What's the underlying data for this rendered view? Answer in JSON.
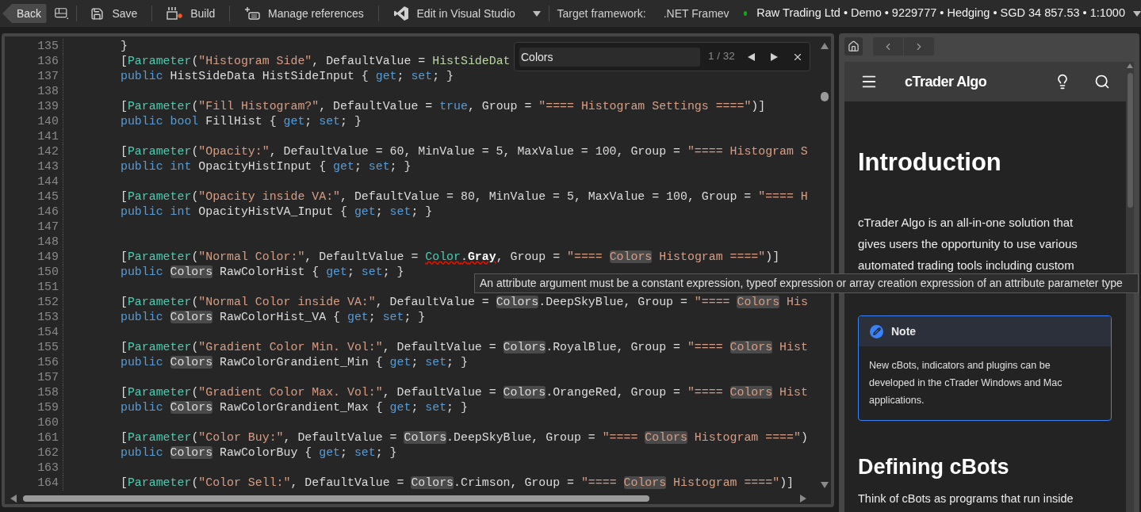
{
  "toolbar": {
    "back": "Back",
    "buttons": [
      {
        "kind": "save",
        "label": "Save"
      },
      {
        "kind": "build",
        "label": "Build"
      },
      {
        "kind": "references",
        "label": "Manage references"
      },
      {
        "kind": "visual-studio",
        "label": "Edit in Visual Studio"
      }
    ],
    "target_framework_label": "Target framework:",
    "target_framework_value": ".NET Framev",
    "account": {
      "connected": true,
      "text": "Raw Trading Ltd • Demo • 9229777 • Hedging • SGD 34 857.53 • 1:1000"
    }
  },
  "editor": {
    "lines": [
      {
        "number": "135",
        "tokens": [
          {
            "kind": "plain",
            "text": "}"
          }
        ]
      },
      {
        "number": "136",
        "tokens": [
          {
            "kind": "plain",
            "text": "["
          },
          {
            "kind": "attribute",
            "text": "Parameter"
          },
          {
            "kind": "plain",
            "text": "("
          },
          {
            "kind": "string",
            "text": "\"Histogram Side\""
          },
          {
            "kind": "plain",
            "text": ", DefaultValue = "
          },
          {
            "kind": "type",
            "text": "HistSideDat"
          }
        ]
      },
      {
        "number": "137",
        "tokens": [
          {
            "kind": "keyword",
            "text": "public"
          },
          {
            "kind": "plain",
            "text": " HistSideData HistSideInput { "
          },
          {
            "kind": "keyword",
            "text": "get"
          },
          {
            "kind": "plain",
            "text": "; "
          },
          {
            "kind": "keyword",
            "text": "set"
          },
          {
            "kind": "plain",
            "text": "; }"
          }
        ]
      },
      {
        "number": "138"
      },
      {
        "number": "139",
        "tokens": [
          {
            "kind": "plain",
            "text": "["
          },
          {
            "kind": "attribute",
            "text": "Parameter"
          },
          {
            "kind": "plain",
            "text": "("
          },
          {
            "kind": "string",
            "text": "\"Fill Histogram?\""
          },
          {
            "kind": "plain",
            "text": ", DefaultValue = "
          },
          {
            "kind": "keyword",
            "text": "true"
          },
          {
            "kind": "plain",
            "text": ", Group = "
          },
          {
            "kind": "string",
            "text": "\"==== Histogram Settings ====\""
          },
          {
            "kind": "plain",
            "text": ")]"
          }
        ]
      },
      {
        "number": "140",
        "tokens": [
          {
            "kind": "keyword",
            "text": "public "
          },
          {
            "kind": "keyword",
            "text": "bool"
          },
          {
            "kind": "plain",
            "text": " FillHist { "
          },
          {
            "kind": "keyword",
            "text": "get"
          },
          {
            "kind": "plain",
            "text": "; "
          },
          {
            "kind": "keyword",
            "text": "set"
          },
          {
            "kind": "plain",
            "text": "; }"
          }
        ]
      },
      {
        "number": "141"
      },
      {
        "number": "142",
        "tokens": [
          {
            "kind": "plain",
            "text": "["
          },
          {
            "kind": "attribute",
            "text": "Parameter"
          },
          {
            "kind": "plain",
            "text": "("
          },
          {
            "kind": "string",
            "text": "\"Opacity:\""
          },
          {
            "kind": "plain",
            "text": ", DefaultValue = 60, MinValue = 5, MaxValue = 100, Group = "
          },
          {
            "kind": "string",
            "text": "\"==== Histogram S"
          }
        ]
      },
      {
        "number": "143",
        "tokens": [
          {
            "kind": "keyword",
            "text": "public "
          },
          {
            "kind": "keyword",
            "text": "int"
          },
          {
            "kind": "plain",
            "text": " OpacityHistInput { "
          },
          {
            "kind": "keyword",
            "text": "get"
          },
          {
            "kind": "plain",
            "text": "; "
          },
          {
            "kind": "keyword",
            "text": "set"
          },
          {
            "kind": "plain",
            "text": "; }"
          }
        ]
      },
      {
        "number": "144"
      },
      {
        "number": "145",
        "tokens": [
          {
            "kind": "plain",
            "text": "["
          },
          {
            "kind": "attribute",
            "text": "Parameter"
          },
          {
            "kind": "plain",
            "text": "("
          },
          {
            "kind": "string",
            "text": "\"Opacity inside VA:\""
          },
          {
            "kind": "plain",
            "text": ", DefaultValue = 80, MinValue = 5, MaxValue = 100, Group = "
          },
          {
            "kind": "string",
            "text": "\"==== H"
          }
        ]
      },
      {
        "number": "146",
        "tokens": [
          {
            "kind": "keyword",
            "text": "public "
          },
          {
            "kind": "keyword",
            "text": "int"
          },
          {
            "kind": "plain",
            "text": " OpacityHistVA_Input { "
          },
          {
            "kind": "keyword",
            "text": "get"
          },
          {
            "kind": "plain",
            "text": "; "
          },
          {
            "kind": "keyword",
            "text": "set"
          },
          {
            "kind": "plain",
            "text": "; }"
          }
        ]
      },
      {
        "number": "147"
      },
      {
        "number": "148"
      },
      {
        "number": "149",
        "tokens": [
          {
            "kind": "plain",
            "text": "["
          },
          {
            "kind": "attribute",
            "text": "Parameter"
          },
          {
            "kind": "plain",
            "text": "("
          },
          {
            "kind": "string",
            "text": "\"Normal Color:\""
          },
          {
            "kind": "plain",
            "text": ", DefaultValue = "
          },
          {
            "kind": "type-error",
            "text": "Color"
          },
          {
            "kind": "plain-error",
            "text": "."
          },
          {
            "kind": "bold-error",
            "text": "Gray"
          },
          {
            "kind": "plain",
            "text": ", Group = "
          },
          {
            "kind": "string",
            "text": "\"==== "
          },
          {
            "kind": "string-match",
            "text": "Colors"
          },
          {
            "kind": "string",
            "text": " Histogram ====\""
          },
          {
            "kind": "plain",
            "text": ")]"
          }
        ]
      },
      {
        "number": "150",
        "tokens": [
          {
            "kind": "keyword",
            "text": "public "
          },
          {
            "kind": "match",
            "text": "Colors"
          },
          {
            "kind": "plain",
            "text": " RawColorHist { "
          },
          {
            "kind": "keyword",
            "text": "get"
          },
          {
            "kind": "plain",
            "text": "; "
          },
          {
            "kind": "keyword",
            "text": "set"
          },
          {
            "kind": "plain",
            "text": "; }"
          }
        ]
      },
      {
        "number": "151"
      },
      {
        "number": "152",
        "tokens": [
          {
            "kind": "plain",
            "text": "["
          },
          {
            "kind": "attribute",
            "text": "Parameter"
          },
          {
            "kind": "plain",
            "text": "("
          },
          {
            "kind": "string",
            "text": "\"Normal Color inside VA:\""
          },
          {
            "kind": "plain",
            "text": ", DefaultValue = "
          },
          {
            "kind": "match",
            "text": "Colors"
          },
          {
            "kind": "plain",
            "text": ".DeepSkyBlue, Group = "
          },
          {
            "kind": "string",
            "text": "\"==== "
          },
          {
            "kind": "string-match",
            "text": "Colors"
          },
          {
            "kind": "string",
            "text": " His"
          }
        ]
      },
      {
        "number": "153",
        "tokens": [
          {
            "kind": "keyword",
            "text": "public "
          },
          {
            "kind": "match",
            "text": "Colors"
          },
          {
            "kind": "plain",
            "text": " RawColorHist_VA { "
          },
          {
            "kind": "keyword",
            "text": "get"
          },
          {
            "kind": "plain",
            "text": "; "
          },
          {
            "kind": "keyword",
            "text": "set"
          },
          {
            "kind": "plain",
            "text": "; }"
          }
        ]
      },
      {
        "number": "154"
      },
      {
        "number": "155",
        "tokens": [
          {
            "kind": "plain",
            "text": "["
          },
          {
            "kind": "attribute",
            "text": "Parameter"
          },
          {
            "kind": "plain",
            "text": "("
          },
          {
            "kind": "string",
            "text": "\"Gradient Color Min. Vol:\""
          },
          {
            "kind": "plain",
            "text": ", DefaultValue = "
          },
          {
            "kind": "match",
            "text": "Colors"
          },
          {
            "kind": "plain",
            "text": ".RoyalBlue, Group = "
          },
          {
            "kind": "string",
            "text": "\"==== "
          },
          {
            "kind": "string-match",
            "text": "Colors"
          },
          {
            "kind": "string",
            "text": " Hist"
          }
        ]
      },
      {
        "number": "156",
        "tokens": [
          {
            "kind": "keyword",
            "text": "public "
          },
          {
            "kind": "match",
            "text": "Colors"
          },
          {
            "kind": "plain",
            "text": " RawColorGrandient_Min { "
          },
          {
            "kind": "keyword",
            "text": "get"
          },
          {
            "kind": "plain",
            "text": "; "
          },
          {
            "kind": "keyword",
            "text": "set"
          },
          {
            "kind": "plain",
            "text": "; }"
          }
        ]
      },
      {
        "number": "157"
      },
      {
        "number": "158",
        "tokens": [
          {
            "kind": "plain",
            "text": "["
          },
          {
            "kind": "attribute",
            "text": "Parameter"
          },
          {
            "kind": "plain",
            "text": "("
          },
          {
            "kind": "string",
            "text": "\"Gradient Color Max. Vol:\""
          },
          {
            "kind": "plain",
            "text": ", DefaultValue = "
          },
          {
            "kind": "match",
            "text": "Colors"
          },
          {
            "kind": "plain",
            "text": ".OrangeRed, Group = "
          },
          {
            "kind": "string",
            "text": "\"==== "
          },
          {
            "kind": "string-match",
            "text": "Colors"
          },
          {
            "kind": "string",
            "text": " Hist"
          }
        ]
      },
      {
        "number": "159",
        "tokens": [
          {
            "kind": "keyword",
            "text": "public "
          },
          {
            "kind": "match",
            "text": "Colors"
          },
          {
            "kind": "plain",
            "text": " RawColorGrandient_Max { "
          },
          {
            "kind": "keyword",
            "text": "get"
          },
          {
            "kind": "plain",
            "text": "; "
          },
          {
            "kind": "keyword",
            "text": "set"
          },
          {
            "kind": "plain",
            "text": "; }"
          }
        ]
      },
      {
        "number": "160"
      },
      {
        "number": "161",
        "tokens": [
          {
            "kind": "plain",
            "text": "["
          },
          {
            "kind": "attribute",
            "text": "Parameter"
          },
          {
            "kind": "plain",
            "text": "("
          },
          {
            "kind": "string",
            "text": "\"Color Buy:\""
          },
          {
            "kind": "plain",
            "text": ", DefaultValue = "
          },
          {
            "kind": "match",
            "text": "Colors"
          },
          {
            "kind": "plain",
            "text": ".DeepSkyBlue, Group = "
          },
          {
            "kind": "string",
            "text": "\"==== "
          },
          {
            "kind": "string-match",
            "text": "Colors"
          },
          {
            "kind": "string",
            "text": " Histogram ====\""
          },
          {
            "kind": "plain",
            "text": ")"
          }
        ]
      },
      {
        "number": "162",
        "tokens": [
          {
            "kind": "keyword",
            "text": "public "
          },
          {
            "kind": "match",
            "text": "Colors"
          },
          {
            "kind": "plain",
            "text": " RawColorBuy { "
          },
          {
            "kind": "keyword",
            "text": "get"
          },
          {
            "kind": "plain",
            "text": "; "
          },
          {
            "kind": "keyword",
            "text": "set"
          },
          {
            "kind": "plain",
            "text": "; }"
          }
        ]
      },
      {
        "number": "163"
      },
      {
        "number": "164",
        "tokens": [
          {
            "kind": "plain",
            "text": "["
          },
          {
            "kind": "attribute",
            "text": "Parameter"
          },
          {
            "kind": "plain",
            "text": "("
          },
          {
            "kind": "string",
            "text": "\"Color Sell:\""
          },
          {
            "kind": "plain",
            "text": ", DefaultValue = "
          },
          {
            "kind": "match",
            "text": "Colors"
          },
          {
            "kind": "plain",
            "text": ".Crimson, Group = "
          },
          {
            "kind": "string",
            "text": "\"==== "
          },
          {
            "kind": "string-match",
            "text": "Colors"
          },
          {
            "kind": "string",
            "text": " Histogram ====\""
          },
          {
            "kind": "plain",
            "text": ")]"
          }
        ]
      }
    ],
    "find": {
      "value": "Colors",
      "count": "1 / 32"
    },
    "tooltip": "An attribute argument must be a constant expression, typeof expression or array creation expression of an attribute parameter type"
  },
  "help": {
    "title": "cTrader Algo",
    "heading": "Introduction",
    "paragraph_lines": [
      "cTrader Algo is an all-in-one solution that",
      "gives users the opportunity to use various",
      "automated trading tools including custom"
    ],
    "note": {
      "title": "Note",
      "lines": [
        "New cBots, indicators and plugins can be",
        "developed in the cTrader Windows and Mac",
        "applications."
      ]
    },
    "heading_2": "Defining cBots",
    "paragraph_2": "Think of cBots as programs that run inside"
  }
}
